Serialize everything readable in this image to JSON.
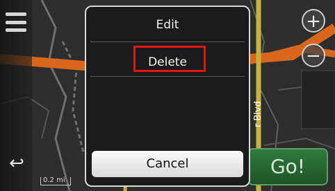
{
  "left_bar": {
    "menu_icon": "hamburger-menu-icon",
    "back_icon": "back-arrow-icon",
    "back_glyph": "↩"
  },
  "zoom": {
    "in_glyph": "+",
    "out_glyph": "−"
  },
  "map": {
    "scale_label": "0.2 mi",
    "street_label": "r Blvd"
  },
  "go_button": {
    "label": "Go!"
  },
  "dialog": {
    "items": [
      {
        "label": "Edit"
      },
      {
        "label": "Delete"
      }
    ],
    "cancel_label": "Cancel",
    "highlight_color": "#ee1111"
  },
  "colors": {
    "highway": "#d8661b",
    "green_go": "#2f7a3e",
    "map_bg": "#2b2b2b"
  }
}
